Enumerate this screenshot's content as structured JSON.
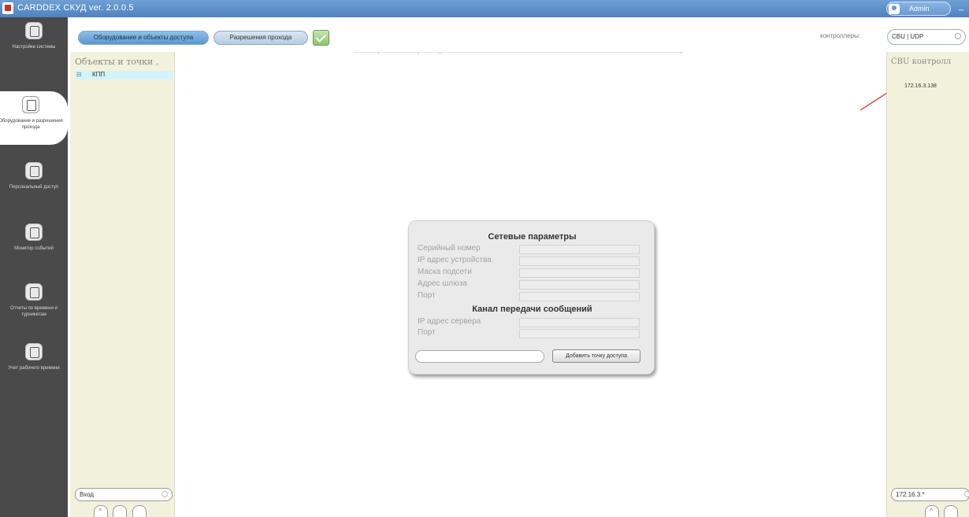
{
  "window": {
    "title": "CARDDEX СКУД ver. 2.0.0.5",
    "user": "Admin",
    "minimize": "_"
  },
  "sidebar": {
    "items": [
      {
        "label": "Настройки системы",
        "icon": "settings-icon"
      },
      {
        "label": "Оборудование и разрешения прохода",
        "icon": "equipment-icon",
        "active": true
      },
      {
        "label": "Персональный доступ",
        "icon": "personal-access-icon"
      },
      {
        "label": "Монитор событий",
        "icon": "monitor-icon"
      },
      {
        "label": "Отчеты по времени и турникетам",
        "icon": "report-icon"
      },
      {
        "label": "Учет рабочего времени",
        "icon": "timesheet-icon"
      }
    ]
  },
  "toolbar": {
    "tab_equipment": "Оборудование и объекты доступа",
    "tab_permissions": "Разрешения прохода",
    "controllers_label": "контроллеры:",
    "controllers_value": "CBU | UDP"
  },
  "left_panel": {
    "title": "Объекты и точки ,",
    "tree_expander": "⊟",
    "tree_item": "КПП",
    "direction_value": "Вход"
  },
  "dialog": {
    "title": "Сетевые параметры",
    "fields": [
      {
        "label": "Серийный номер",
        "value": ""
      },
      {
        "label": "IP адрес устройства",
        "value": ""
      },
      {
        "label": "Маска подсети",
        "value": ""
      },
      {
        "label": "Адрес шлюза",
        "value": ""
      },
      {
        "label": "Порт",
        "value": ""
      }
    ],
    "section2_title": "Канал передачи сообщений",
    "fields2": [
      {
        "label": "IP адрес сервера",
        "value": ""
      },
      {
        "label": "Порт",
        "value": ""
      }
    ],
    "add_button": "Добавить точку доступа"
  },
  "right_panel": {
    "title": "CBU контролл",
    "controller_ip": "172.16.3.138",
    "ip_filter": "172.16.3.*"
  },
  "colors": {
    "titlebar": "#5a8cc8",
    "sidebar": "#4a4a4a",
    "panel": "#f2f2dc",
    "annotation_arrow": "#d83030"
  }
}
